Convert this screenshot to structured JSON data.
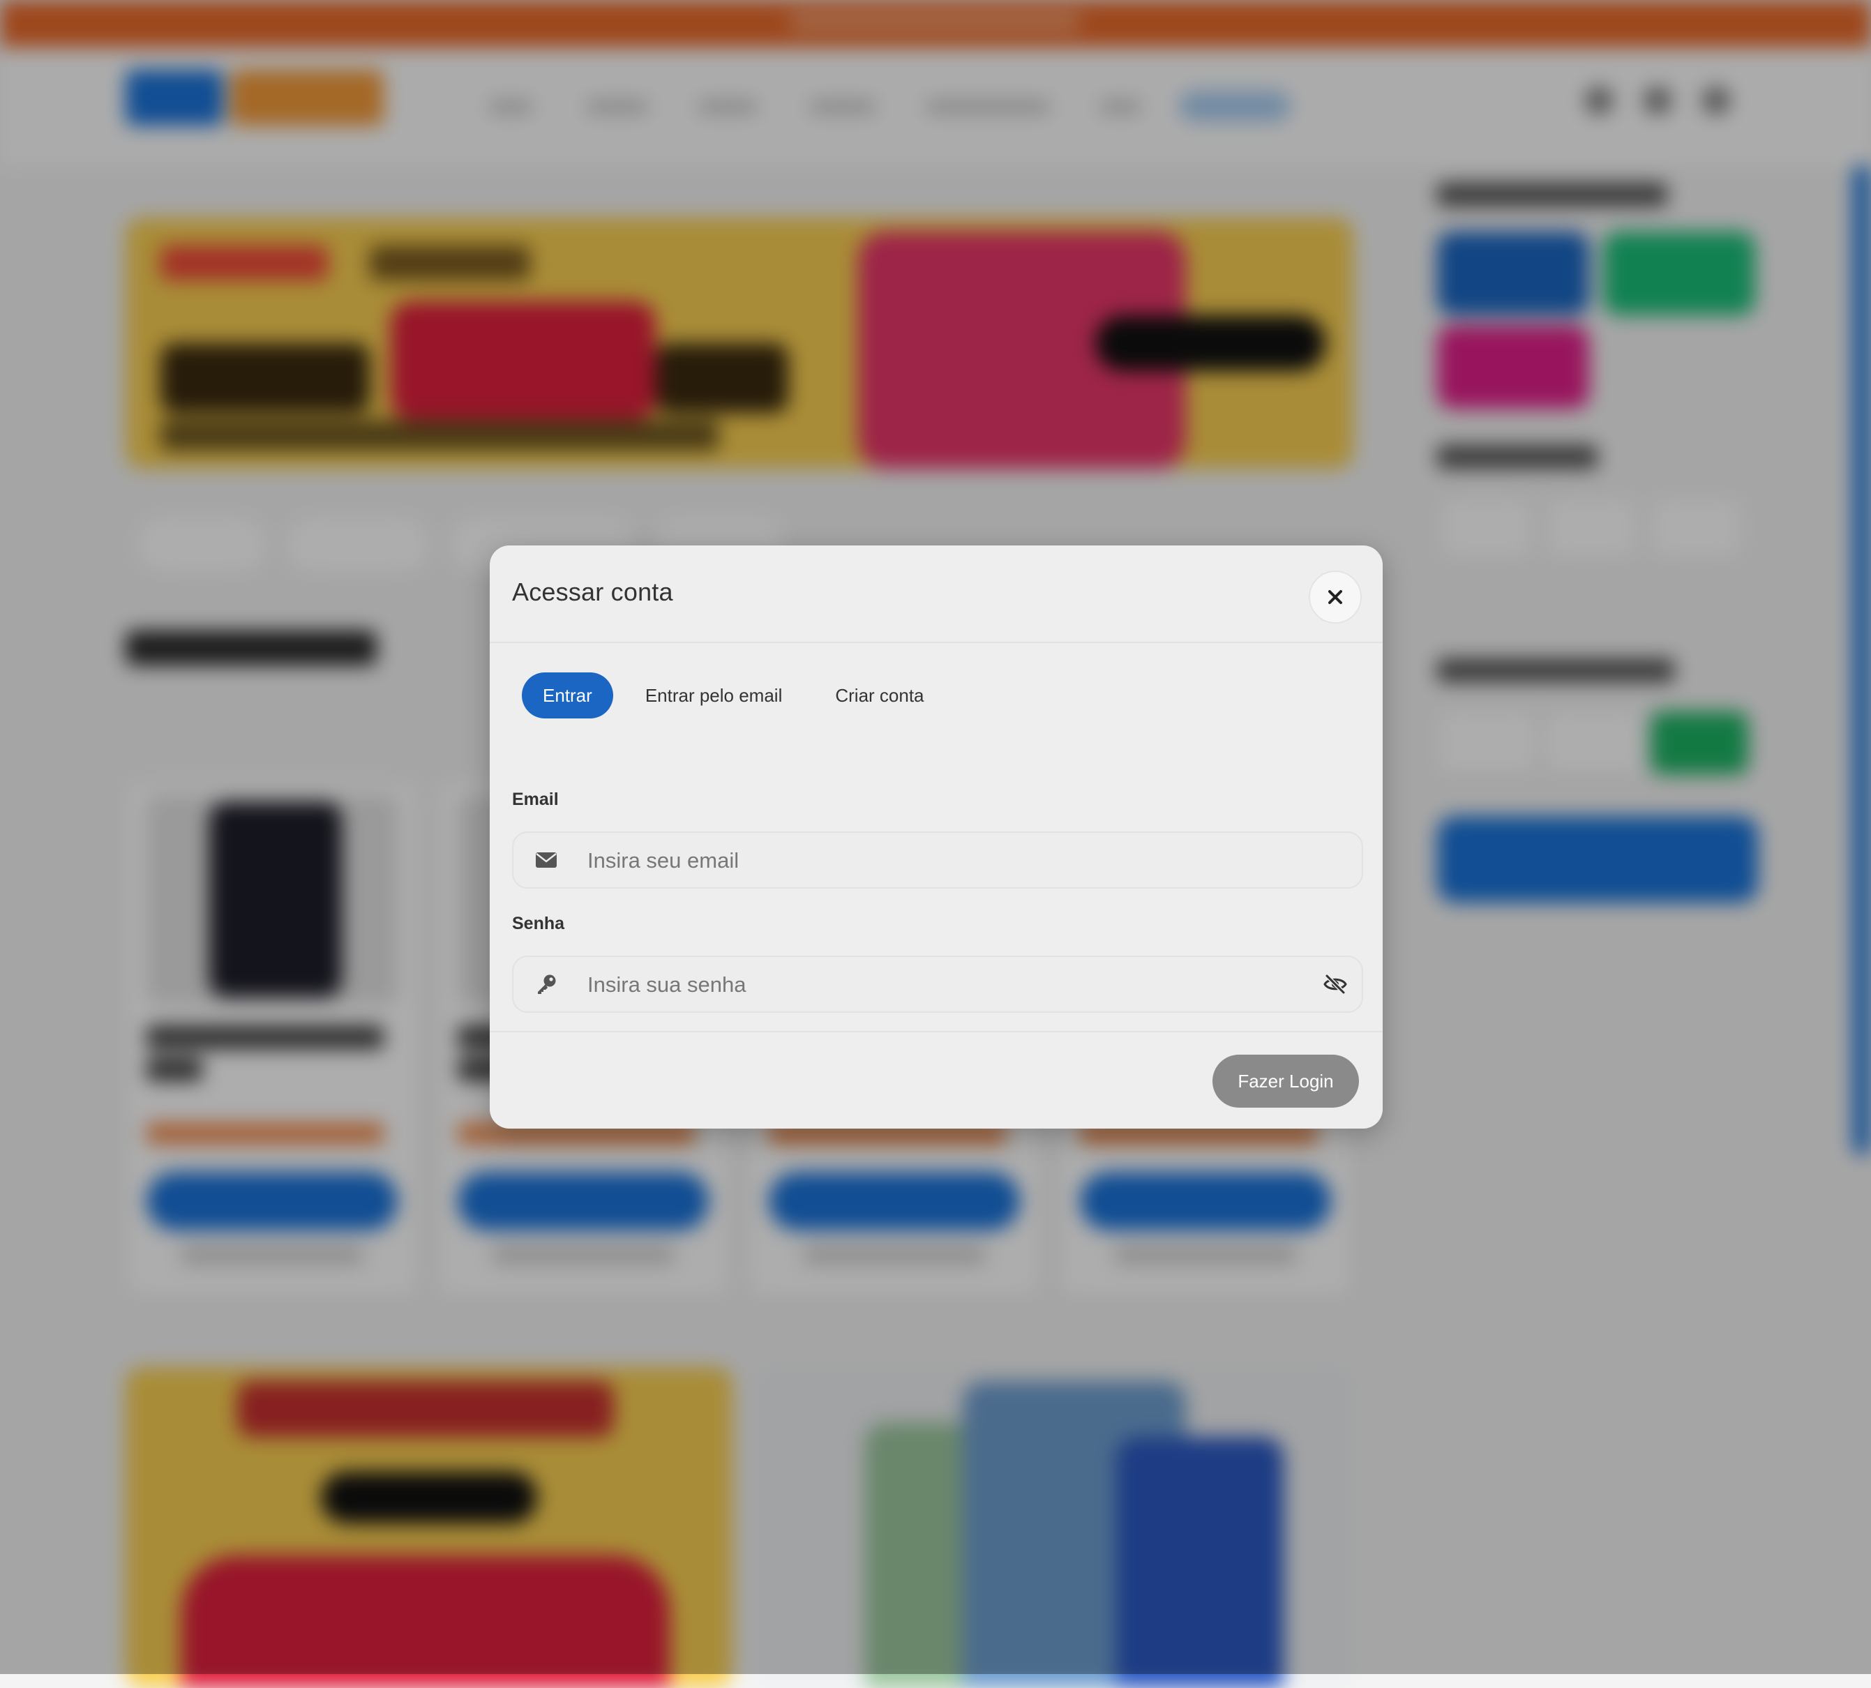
{
  "modal": {
    "title": "Acessar conta",
    "close_icon": "close-icon",
    "tabs": [
      {
        "label": "Entrar",
        "active": true
      },
      {
        "label": "Entrar pelo email",
        "active": false
      },
      {
        "label": "Criar conta",
        "active": false
      }
    ],
    "email": {
      "label": "Email",
      "placeholder": "Insira seu email",
      "value": "",
      "icon": "envelope-icon"
    },
    "password": {
      "label": "Senha",
      "placeholder": "Insira sua senha",
      "value": "",
      "icon": "key-icon",
      "toggle_icon": "eye-slash-icon"
    },
    "submit_label": "Fazer Login"
  },
  "colors": {
    "accent": "#1a66c2",
    "submit_disabled": "#8a8a8a",
    "banner_top": "#e8692a"
  }
}
